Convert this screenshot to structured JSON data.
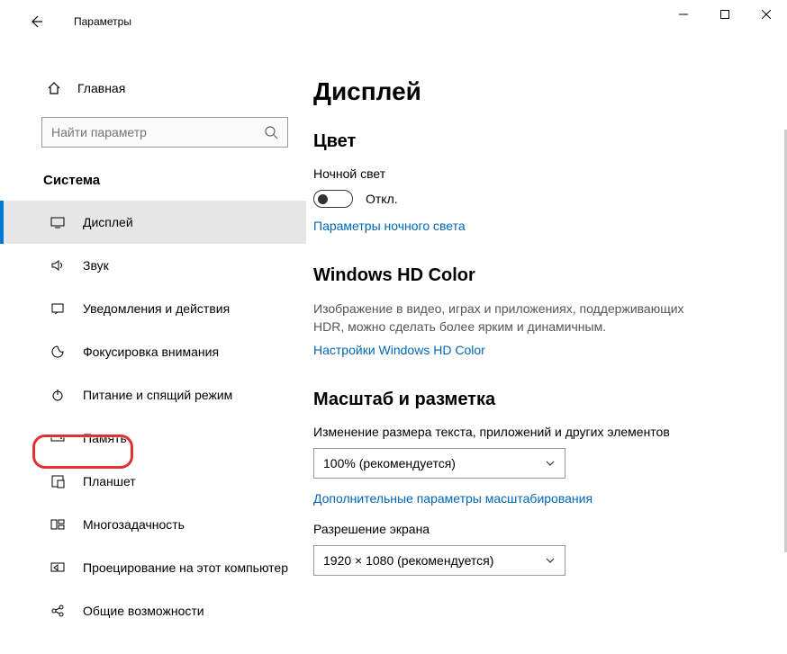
{
  "window": {
    "app_title": "Параметры"
  },
  "sidebar": {
    "home_label": "Главная",
    "search_placeholder": "Найти параметр",
    "section_title": "Система",
    "items": [
      {
        "label": "Дисплей"
      },
      {
        "label": "Звук"
      },
      {
        "label": "Уведомления и действия"
      },
      {
        "label": "Фокусировка внимания"
      },
      {
        "label": "Питание и спящий режим"
      },
      {
        "label": "Память"
      },
      {
        "label": "Планшет"
      },
      {
        "label": "Многозадачность"
      },
      {
        "label": "Проецирование на этот компьютер"
      },
      {
        "label": "Общие возможности"
      }
    ]
  },
  "content": {
    "page_title": "Дисплей",
    "color": {
      "header": "Цвет",
      "night_light_label": "Ночной свет",
      "toggle_state": "Откл.",
      "night_light_link": "Параметры ночного света"
    },
    "hd": {
      "header": "Windows HD Color",
      "description": "Изображение в видео, играх и приложениях, поддерживающих HDR, можно сделать более ярким и динамичным.",
      "link": "Настройки Windows HD Color"
    },
    "scale": {
      "header": "Масштаб и разметка",
      "scale_label": "Изменение размера текста, приложений и других элементов",
      "scale_value": "100% (рекомендуется)",
      "advanced_link": "Дополнительные параметры масштабирования",
      "resolution_label": "Разрешение экрана",
      "resolution_value": "1920 × 1080 (рекомендуется)"
    }
  }
}
